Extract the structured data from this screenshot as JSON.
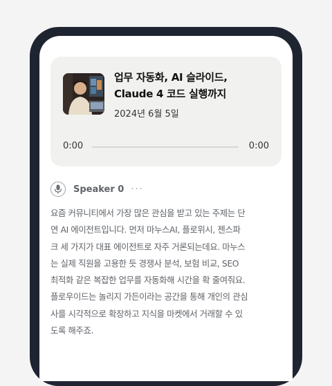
{
  "episode": {
    "title_lines": [
      "업무 자동화, AI 슬라이드,",
      "Claude 4 코드 실행까지"
    ],
    "date": "2024년 6월 5일",
    "thumbnail_icon": "podcast-cover-image"
  },
  "player": {
    "current_time": "0:00",
    "duration": "0:00",
    "progress_fraction": 0
  },
  "speaker": {
    "name": "Speaker 0",
    "avatar_icon": "microphone-icon",
    "more_label": "···"
  },
  "transcript": {
    "lines": [
      "요즘 커뮤니티에서 가장 많은 관심을 받고 있는 주제는 단",
      "연 AI 에이전트입니다. 먼저 마누스AI, 플로위시, 젠스파",
      "크 세 가지가 대표 에이전트로 자주 거론되는데요. 마누스",
      "는 실제 직원을 고용한 듯 경쟁사 분석, 보험 비교, SEO",
      "최적화 같은 복잡한 업무를 자동화해 시간을 확 줄여줘요.",
      "플로우이드는 놀리지 가든이라는 공간을 통해 개인의 관심",
      "사를 시각적으로 확장하고 지식을 마켓에서 거래할 수 있",
      "도록 해주죠."
    ]
  },
  "colors": {
    "background": "#f4f4f5",
    "phone_frame": "#1e2430",
    "card": "#f1f1ef",
    "muted_text": "#5f6368"
  }
}
